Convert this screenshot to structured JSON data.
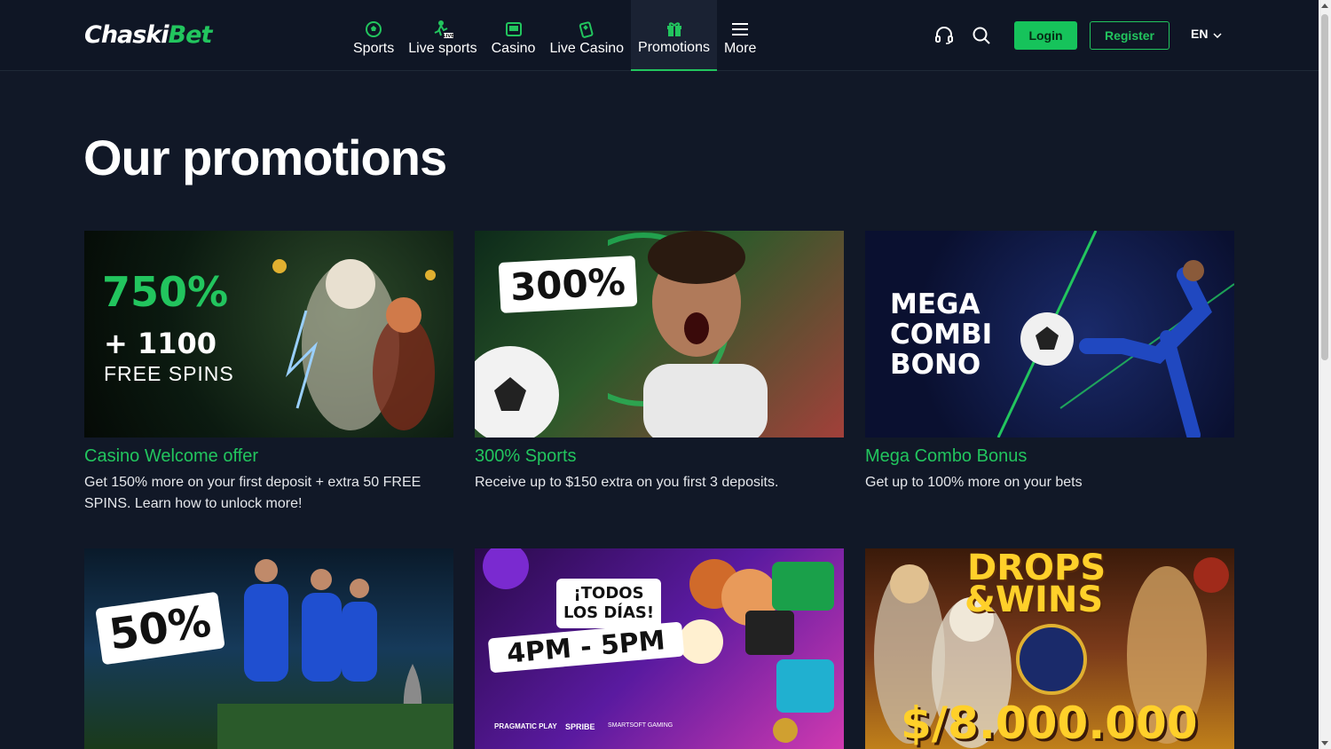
{
  "header": {
    "logo": {
      "part1": "Chaski",
      "part2": "Bet"
    },
    "nav": [
      {
        "label": "Sports",
        "icon": "soccer-ball-icon"
      },
      {
        "label": "Live sports",
        "icon": "live-player-icon"
      },
      {
        "label": "Casino",
        "icon": "slot-machine-icon"
      },
      {
        "label": "Live Casino",
        "icon": "cards-icon"
      },
      {
        "label": "Promotions",
        "icon": "gift-icon",
        "active": true
      },
      {
        "label": "More",
        "icon": "menu-icon"
      }
    ],
    "login_label": "Login",
    "register_label": "Register",
    "language": "EN"
  },
  "page": {
    "title": "Our promotions"
  },
  "promotions": [
    {
      "title": "Casino Welcome offer",
      "description": "Get 150% more on your first deposit + extra 50 FREE SPINS. Learn how to unlock more!",
      "banner": {
        "headline": "750%",
        "line2": "+ 1100",
        "line3": "FREE SPINS"
      }
    },
    {
      "title": "300% Sports",
      "description": "Receive up to $150 extra on you first 3 deposits.",
      "banner": {
        "headline": "300%"
      }
    },
    {
      "title": "Mega Combo Bonus",
      "description": "Get up to 100% more on your bets",
      "banner": {
        "line1": "MEGA",
        "line2": "COMBI",
        "line3": "BONO"
      }
    },
    {
      "title": "",
      "description": "",
      "banner": {
        "headline": "50%"
      }
    },
    {
      "title": "",
      "description": "",
      "banner": {
        "line1": "¡TODOS",
        "line2": "LOS DÍAS!",
        "line3": "4PM - 5PM",
        "providers": [
          "PRAGMATIC PLAY",
          "SPRIBE",
          "SMARTSOFT GAMING"
        ]
      }
    },
    {
      "title": "",
      "description": "",
      "banner": {
        "line1": "DROPS",
        "line2": "&WINS",
        "amount": "$/8.000.000"
      }
    }
  ],
  "colors": {
    "accent": "#22c55e",
    "background": "#111827",
    "topbar": "#0f1625"
  }
}
